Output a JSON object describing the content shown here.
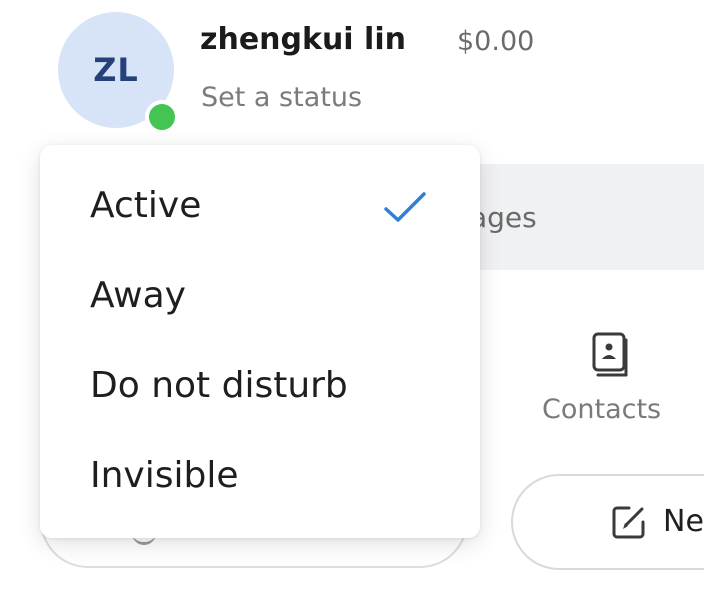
{
  "profile": {
    "initials": "ZL",
    "name": "zhengkui lin",
    "balance": "$0.00",
    "status_prompt": "Set a status",
    "avatar_color": "#d7e4f8",
    "presence_color": "#44c553"
  },
  "search": {
    "partial_text": "ages"
  },
  "contacts": {
    "icon": "contact-book-icon",
    "label": "Contacts"
  },
  "new_button": {
    "icon": "compose-icon",
    "label": "Ne"
  },
  "status_menu": {
    "items": [
      {
        "label": "Active",
        "selected": true
      },
      {
        "label": "Away",
        "selected": false
      },
      {
        "label": "Do not disturb",
        "selected": false
      },
      {
        "label": "Invisible",
        "selected": false
      }
    ],
    "check_color": "#2f7fd6"
  }
}
